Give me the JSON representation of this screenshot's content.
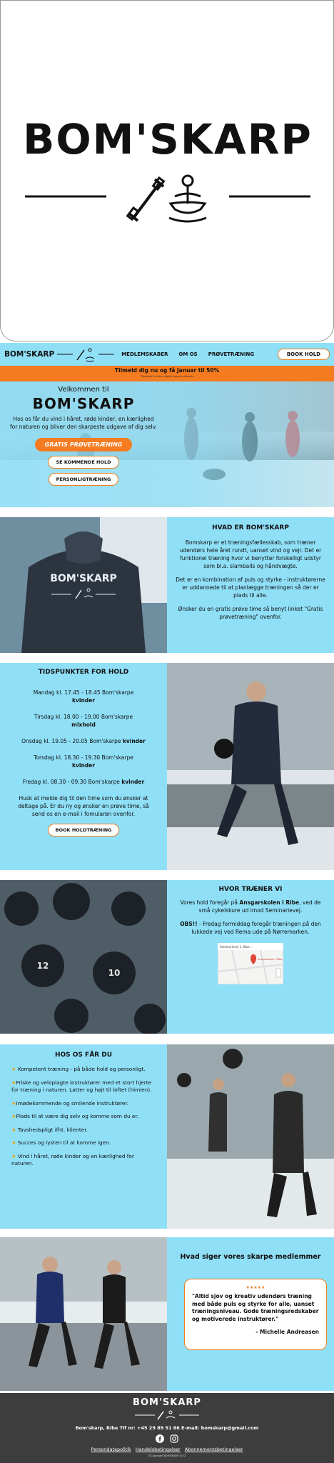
{
  "brand": "BOM'SKARP",
  "nav": {
    "brand": "BOM'SKARP",
    "links": [
      "MEDLEMSKABER",
      "OM OS",
      "PRØVETRÆNING"
    ],
    "cta": "BOOK HOLD"
  },
  "promo": {
    "main": "Tilmeld dig nu og få Januar til 50%",
    "sub": "Tilbuddet fra ikke udløbet beseres allerede"
  },
  "welcome": {
    "small": "Velkommen til",
    "big": "BOM'SKARP",
    "text": "Hos os får du vind i håret, røde kinder, en kærlighed for naturen og bliver den skarpeste udgave af dig selv.",
    "btn_trial": "GRATIS PRØVETRÆNING",
    "btn_upcoming": "SE KOMMENDE HOLD",
    "btn_personal": "PERSONLIGTRÆNING"
  },
  "about": {
    "title": "HVAD ER BOM'SKARP",
    "p1": "Bomskarp er et træningsfællesskab, som træner udendørs hele året rundt, uanset vind og vejr. Det er funktionel træning hvor vi benytter forskelligt udstyr som bl.a. slamballs og håndvægte.",
    "p2": "Det er en kombination af puls og styrke - instruktørerne er uddannede til at planlægge træningen så der er plads til alle.",
    "p3": "Ønsker du en gratis prøve time så benyt linket \"Gratis prøvetræning\" ovenfor.",
    "shirt_text": "BOM'SKARP"
  },
  "schedule": {
    "title": "TIDSPUNKTER FOR HOLD",
    "items": [
      {
        "time": "Mandag kl. 17.45 - 18.45 Bom'skarpe",
        "type": "kvinder"
      },
      {
        "time": "Tirsdag kl. 18.00 - 19.00 Bom'skarpe",
        "type": "mixhold"
      },
      {
        "time": "Onsdag kl. 19.05 - 20.05 Bom'skarpe",
        "type": "kvinder"
      },
      {
        "time": "Torsdag kl. 18.30 - 19.30 Bom'skarpe",
        "type": "kvinder"
      },
      {
        "time": "Fredag kl. 08.30 - 09.30 Bom'skarpe",
        "type": "kvinder"
      }
    ],
    "note": "Husk at melde dig til den time som du ønsker at deltage på. Er du ny og ønsker en prøve time, så send os en e-mail i fomularen ovenfor.",
    "btn": "BOOK HOLDTRÆNING"
  },
  "where": {
    "title": "HVOR TRÆNER VI",
    "p1_pre": "Vores hold foregår på ",
    "p1_bold": "Ansgarskolen i Ribe",
    "p1_post": ", ved de små cykelskure ud imod Seminarievej.",
    "p2_bold": "OBS!!",
    "p2_post": " - Fredag formiddag foregår træningen på den lukkede vej ved Rema ude på Nørremarken.",
    "map_label": "Ansgarskolen i Ribe",
    "map_header": "Seminarievej 1, Ribe..."
  },
  "features": {
    "title": "HOS OS FÅR DU",
    "items": [
      "Kompetent træning - på både hold og personligt.",
      "Friske og veloplagte instruktører med et stort hjerte for træning i naturen. Latter og højt til loftet (himlen).",
      "Imødekommende og smilende instruktører.",
      "Plads til at være dig selv og komme som du er.",
      "Tavshedspligt ifht. klienter.",
      "Succes og lysten til at komme igen.",
      "Vind i håret, røde kinder og en kærlighed for naturen."
    ]
  },
  "reviews": {
    "title": "Hvad siger vores skarpe medlemmer",
    "stars": "★★★★★",
    "quote": "\"Altid sjov og kreativ udendørs træning med både puls og styrke for alle, uanset træningsniveau. Gode træningsredskaber og motiverede instruktører.\"",
    "author": "- Michelle Andreasen"
  },
  "footer": {
    "brand": "BOM'SKARP",
    "contact": "Bom'skarp, Ribe   Tlf nr: +45 29 89 51 86   E-mail: bomskarp@gmail.com",
    "links": [
      "Persondatapolitik",
      "Handelsbetingelser",
      "Abonnementsbetingelser"
    ],
    "copyright": "©Copyright BOM'SKARP 2022"
  },
  "colors": {
    "accent": "#f47b20",
    "light_blue": "#8fdff7",
    "footer": "#3d3d3d"
  },
  "icons": [
    "dumbbell-icon",
    "meditation-icon",
    "facebook-icon",
    "instagram-icon",
    "star-icon",
    "map-pin-icon"
  ]
}
